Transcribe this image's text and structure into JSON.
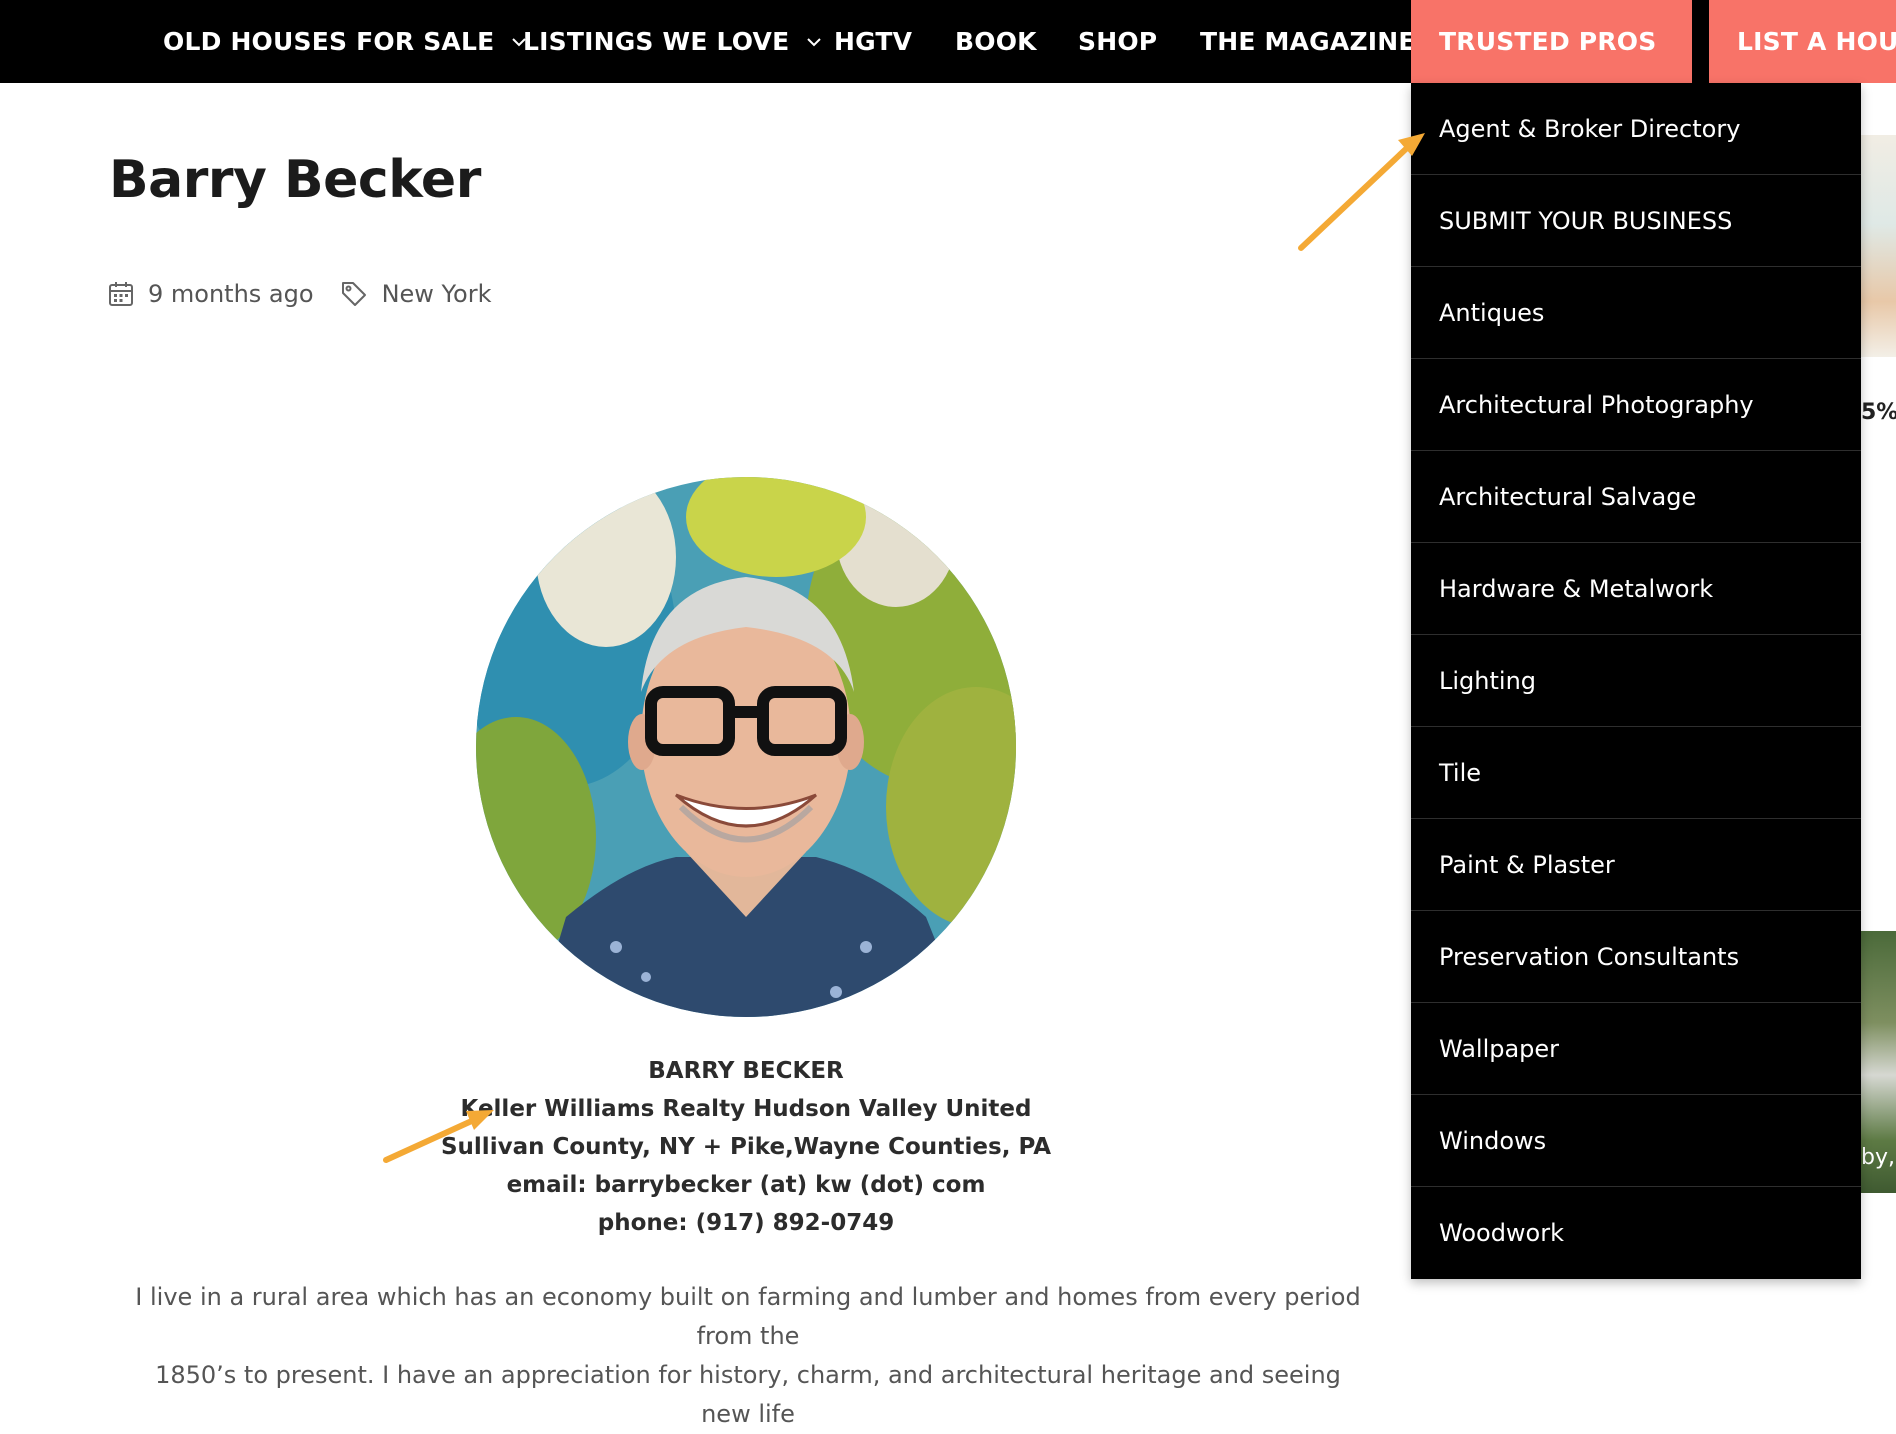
{
  "nav": {
    "items": [
      {
        "label": "OLD HOUSES FOR SALE",
        "has_dropdown": true
      },
      {
        "label": "LISTINGS WE LOVE",
        "has_dropdown": true
      },
      {
        "label": "HGTV"
      },
      {
        "label": "BOOK"
      },
      {
        "label": "SHOP"
      },
      {
        "label": "THE MAGAZINE"
      },
      {
        "label": "TRUSTED PROS",
        "has_dropdown": true,
        "active": true
      },
      {
        "label": "LIST A HOUSE"
      }
    ],
    "accent_color": "#f87368"
  },
  "dropdown": {
    "items": [
      "Agent & Broker Directory",
      "SUBMIT YOUR BUSINESS",
      "Antiques",
      "Architectural Photography",
      "Architectural Salvage",
      "Hardware & Metalwork",
      "Lighting",
      "Tile",
      "Paint & Plaster",
      "Preservation Consultants",
      "Wallpaper",
      "Windows",
      "Woodwork"
    ]
  },
  "post": {
    "title": "Barry Becker",
    "posted": "9 months ago",
    "tag": "New York"
  },
  "profile": {
    "name": "BARRY BECKER",
    "company": "Keller Williams Realty Hudson Valley United",
    "area": "Sullivan County, NY + Pike,Wayne Counties, PA",
    "email": "email: barrybecker (at) kw (dot) com",
    "phone": "phone: (917) 892-0749"
  },
  "bio": {
    "line1": "I live in a rural area which has an economy built on farming and lumber and homes from every period from the",
    "line2": "1850’s to present. I have an appreciation for history, charm, and architectural heritage and seeing new life"
  },
  "edge": {
    "text1": "5%",
    "text2": "by,"
  },
  "icons": {
    "calendar": "calendar-icon",
    "tag": "tag-icon",
    "chevron": "chevron-down-icon"
  },
  "annotation_color": "#f4a935"
}
